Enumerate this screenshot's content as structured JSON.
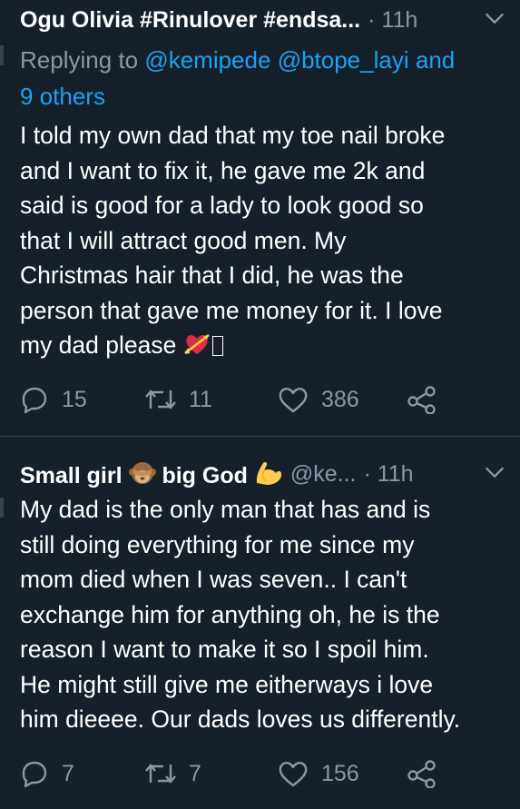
{
  "tweets": [
    {
      "author_name": "Ogu Olivia #Rinulover #endsa...",
      "time": "· 11h",
      "replying_prefix": "Replying to ",
      "mentions": [
        "@kemipede",
        "@btope_layi"
      ],
      "mentions_connector": "and",
      "others": "9 others",
      "text_lines": [
        "I told my own dad that my toe nail broke",
        "and I want to fix it, he gave me 2k and",
        "said is good for a lady to look good so",
        "that I will attract good men. My",
        "Christmas hair that I did, he was the",
        "person that gave me money for it. I love",
        "my dad please"
      ],
      "replies": "15",
      "retweets": "11",
      "likes": "386"
    },
    {
      "author_name_part1": "Small girl",
      "author_name_part2": "big God",
      "handle": "@ke...",
      "time": "· 11h",
      "text_lines": [
        "My dad is the only man that has and is",
        "still doing everything for me since my",
        "mom died when I was seven.. I can't",
        "exchange him for anything oh, he is the",
        "reason I want to make it so I spoil him.",
        "He might still give me eitherways i love",
        "him dieeee. Our dads loves us differently."
      ],
      "replies": "7",
      "retweets": "7",
      "likes": "156"
    }
  ],
  "icons": {
    "reply": "reply-icon",
    "retweet": "retweet-icon",
    "like": "heart-icon",
    "share": "share-icon",
    "menu": "chevron-down-icon",
    "emoji_heart_arrow": "heart-with-arrow-emoji",
    "emoji_monkey": "see-no-evil-monkey-emoji",
    "emoji_muscle": "flexed-biceps-emoji"
  },
  "colors": {
    "background": "#15202b",
    "text": "#ffffff",
    "secondary": "#8899a6",
    "link": "#1da1f2",
    "divider": "#38444d"
  }
}
